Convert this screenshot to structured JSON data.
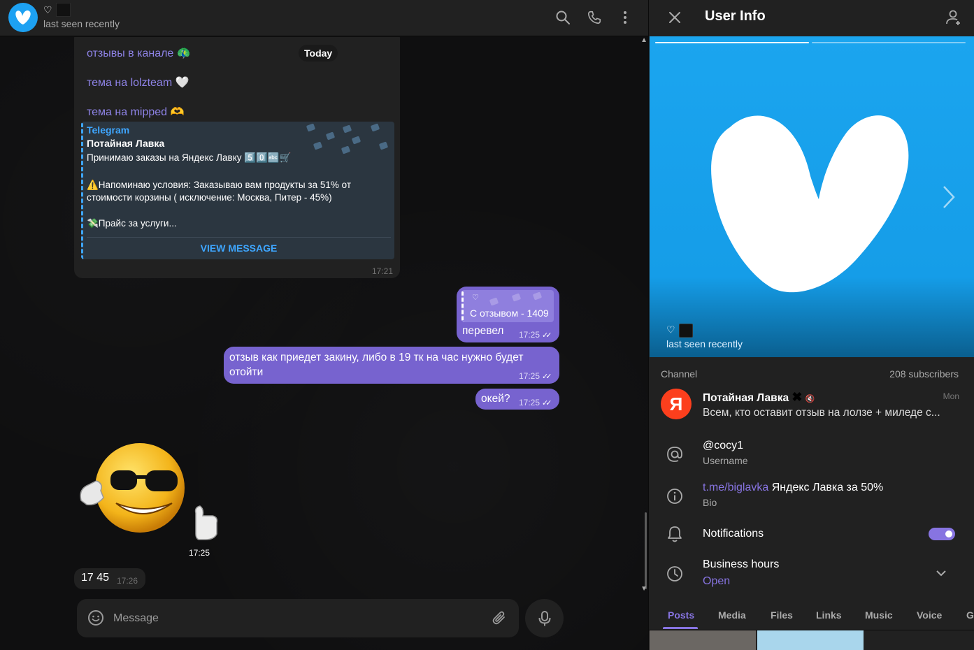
{
  "chat_header": {
    "heart": "♡",
    "status": "last seen recently",
    "icons": [
      "search-icon",
      "phone-icon",
      "more-vertical-icon"
    ]
  },
  "chat": {
    "today": "Today",
    "links": [
      {
        "text": "отзывы в канале",
        "emoji": "🦚"
      },
      {
        "text": "тема на lolzteam",
        "emoji": "🤍"
      },
      {
        "text": "тема на mipped",
        "emoji": "🫶"
      }
    ],
    "preview": {
      "site": "Telegram",
      "title": "Потайная Лавка",
      "line1": "Принимаю заказы на Яндекс Лавку 5️⃣0️⃣🔤🛒",
      "line2": "⚠️Напоминаю условия: Заказываю вам продукты за 51% от",
      "line3": "стоимости корзины ( исключение: Москва, Питер - 45%)",
      "line4": "💸Прайс за услуги...",
      "view": "VIEW MESSAGE"
    },
    "in_time": "17:21",
    "out_messages": [
      {
        "reply_heart": "♡",
        "reply_text": "С отзывом - 1409",
        "text": "перевел",
        "time": "17:25",
        "check": "✓✓"
      },
      {
        "text": "отзыв как приедет закину, либо в 19 тк на час нужно будет отойти",
        "time": "17:25",
        "check": "✓✓"
      },
      {
        "text": "окей?",
        "time": "17:25",
        "check": "✓✓"
      }
    ],
    "sticker_time": "17:25",
    "last_in": {
      "text": "17 45",
      "time": "17:26"
    },
    "composer_placeholder": "Message"
  },
  "right_panel": {
    "title": "User Info",
    "hero_heart": "♡",
    "hero_status": "last seen recently",
    "channel_label": "Channel",
    "subscribers": "208 subscribers",
    "channel": {
      "avatar_letter": "Я",
      "name": "Потайная Лавка",
      "name_emoji": "✖",
      "mute": "🔇",
      "date": "Mon",
      "preview": "Всем, кто оставит отзыв на лолзе + миледе с..."
    },
    "username": {
      "value": "@cocy1",
      "label": "Username"
    },
    "bio": {
      "link": "t.me/biglavka",
      "text": " Яндекс Лавка за 50%",
      "label": "Bio"
    },
    "notifications": {
      "label": "Notifications",
      "enabled": true
    },
    "business": {
      "label": "Business hours",
      "status": "Open"
    },
    "tabs": [
      "Posts",
      "Media",
      "Files",
      "Links",
      "Music",
      "Voice",
      "G"
    ],
    "active_tab": "Posts",
    "colors": {
      "accent": "#8774e1",
      "bubble_out": "#7763cf",
      "link": "#3ea6ff",
      "hero": "#1ba5ef"
    }
  }
}
